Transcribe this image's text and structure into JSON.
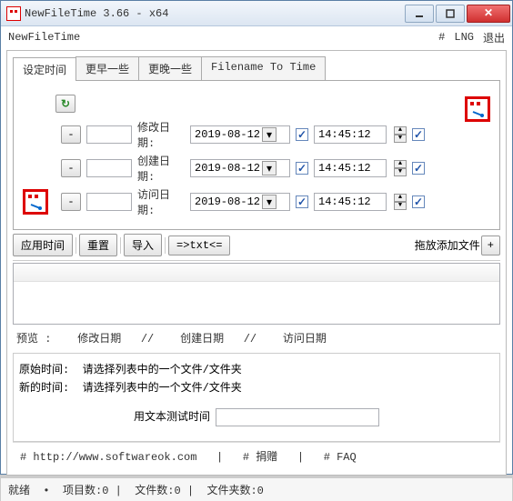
{
  "window": {
    "title": "NewFileTime 3.66 - x64"
  },
  "menubar": {
    "brand": "NewFileTime",
    "hash": "#",
    "lng": "LNG",
    "exit": "退出"
  },
  "tabs": {
    "t1": "设定时间",
    "t2": "更早一些",
    "t3": "更晚一些",
    "t4": "Filename To Time"
  },
  "labels": {
    "modify": "修改日期:",
    "create": "创建日期:",
    "access": "访问日期:"
  },
  "rows": {
    "modify": {
      "date": "2019-08-12",
      "time": "14:45:12"
    },
    "create": {
      "date": "2019-08-12",
      "time": "14:45:12"
    },
    "access": {
      "date": "2019-08-12",
      "time": "14:45:12"
    },
    "minus": "-",
    "check": "✓"
  },
  "toolbar": {
    "apply": "应用时间",
    "reset": "重置",
    "import": "导入",
    "txt": "=>txt<=",
    "drag": "拖放添加文件",
    "plus": "+"
  },
  "preview": {
    "pv": "预览",
    "sep": "//",
    "modify": "修改日期",
    "create": "创建日期",
    "access": "访问日期"
  },
  "info": {
    "orig_lbl": "原始时间:",
    "new_lbl": "新的时间:",
    "msg": "请选择列表中的一个文件/文件夹"
  },
  "test": {
    "label": "用文本测试时间",
    "value": ""
  },
  "footer": {
    "url": "# http://www.softwareok.com",
    "sep": "|",
    "donate": "# 捐赠",
    "faq": "# FAQ"
  },
  "status": {
    "ready": "就绪",
    "sep": "•",
    "items": "项目数:0",
    "files": "文件数:0",
    "folders": "文件夹数:0"
  }
}
